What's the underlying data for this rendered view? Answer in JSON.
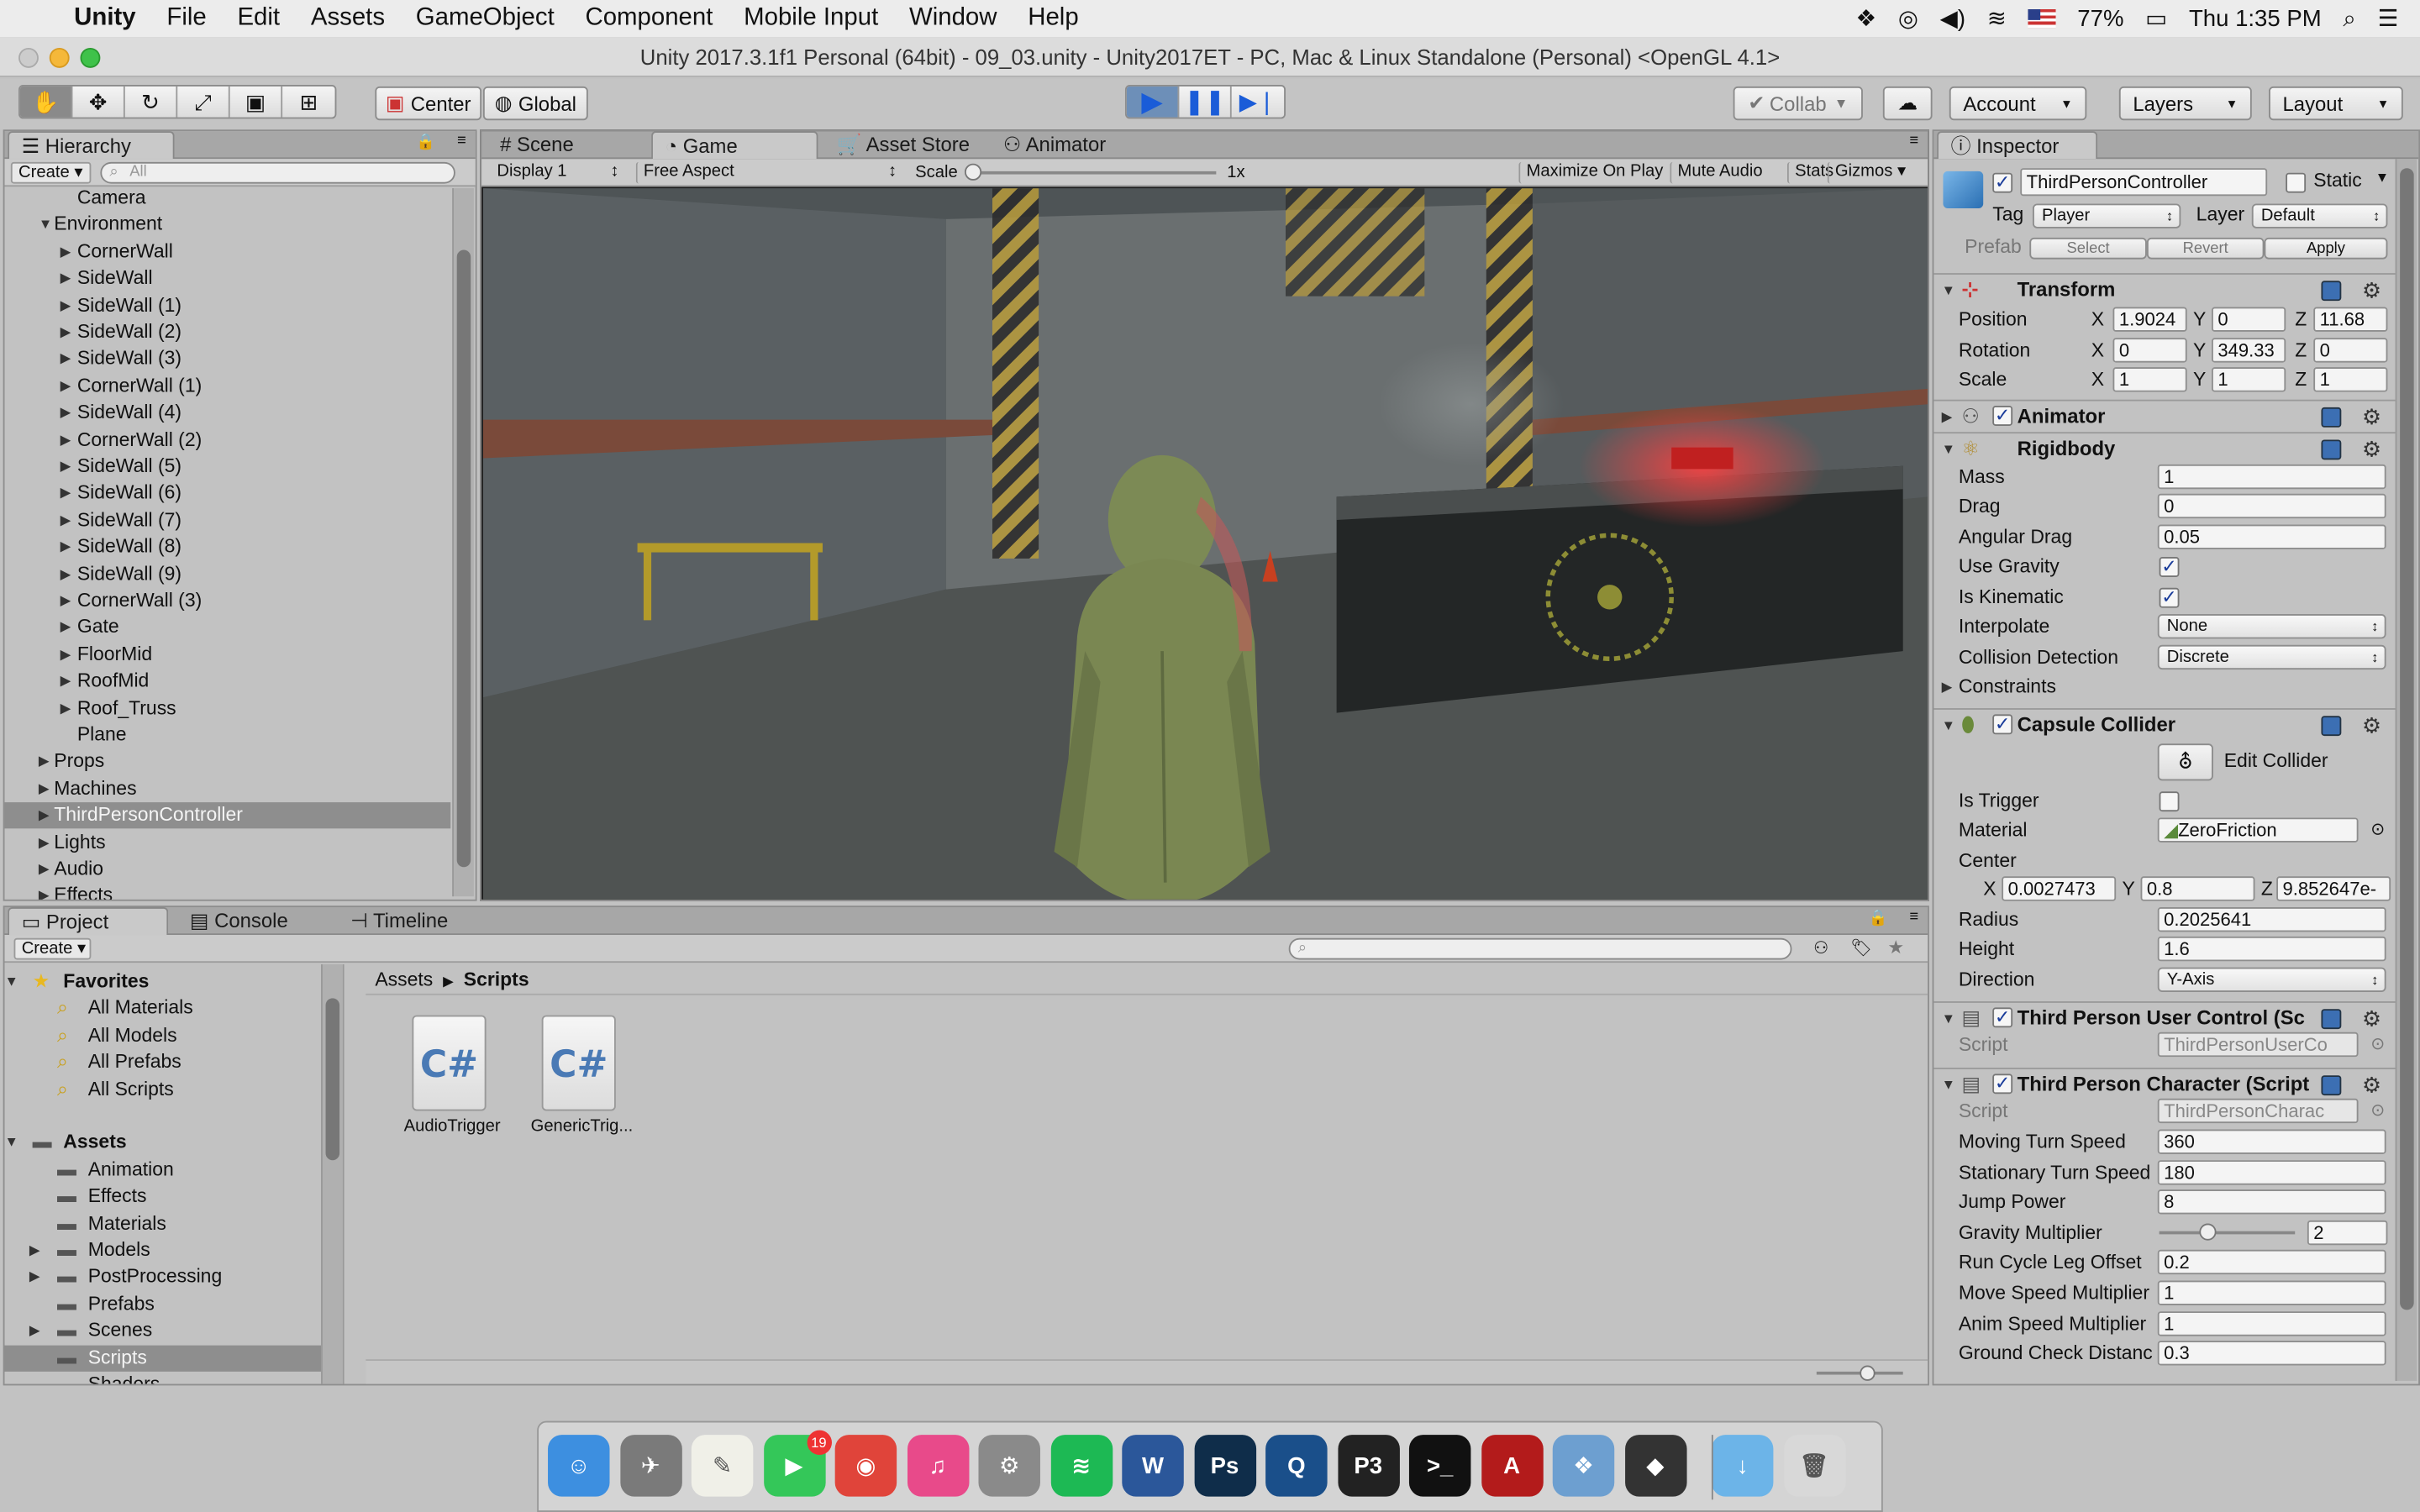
{
  "menubar": {
    "app": "Unity",
    "items": [
      "File",
      "Edit",
      "Assets",
      "GameObject",
      "Component",
      "Mobile Input",
      "Window",
      "Help"
    ],
    "battery": "77%",
    "clock": "Thu 1:35 PM"
  },
  "window": {
    "title": "Unity 2017.3.1f1 Personal (64bit) - 09_03.unity - Unity2017ET - PC, Mac & Linux Standalone (Personal) <OpenGL 4.1>"
  },
  "toolbar": {
    "pivot": "Center",
    "space": "Global",
    "collab": "Collab",
    "account": "Account",
    "layers": "Layers",
    "layout": "Layout"
  },
  "hierarchy": {
    "tab": "Hierarchy",
    "create": "Create",
    "search_placeholder": "All",
    "items": [
      {
        "label": "Camera",
        "indent": 2,
        "arrow": ""
      },
      {
        "label": "Environment",
        "indent": 1,
        "arrow": "down"
      },
      {
        "label": "CornerWall",
        "indent": 2,
        "arrow": "right"
      },
      {
        "label": "SideWall",
        "indent": 2,
        "arrow": "right"
      },
      {
        "label": "SideWall (1)",
        "indent": 2,
        "arrow": "right"
      },
      {
        "label": "SideWall (2)",
        "indent": 2,
        "arrow": "right"
      },
      {
        "label": "SideWall (3)",
        "indent": 2,
        "arrow": "right"
      },
      {
        "label": "CornerWall (1)",
        "indent": 2,
        "arrow": "right"
      },
      {
        "label": "SideWall (4)",
        "indent": 2,
        "arrow": "right"
      },
      {
        "label": "CornerWall (2)",
        "indent": 2,
        "arrow": "right"
      },
      {
        "label": "SideWall (5)",
        "indent": 2,
        "arrow": "right"
      },
      {
        "label": "SideWall (6)",
        "indent": 2,
        "arrow": "right"
      },
      {
        "label": "SideWall (7)",
        "indent": 2,
        "arrow": "right"
      },
      {
        "label": "SideWall (8)",
        "indent": 2,
        "arrow": "right"
      },
      {
        "label": "SideWall (9)",
        "indent": 2,
        "arrow": "right"
      },
      {
        "label": "CornerWall (3)",
        "indent": 2,
        "arrow": "right"
      },
      {
        "label": "Gate",
        "indent": 2,
        "arrow": "right"
      },
      {
        "label": "FloorMid",
        "indent": 2,
        "arrow": "right"
      },
      {
        "label": "RoofMid",
        "indent": 2,
        "arrow": "right"
      },
      {
        "label": "Roof_Truss",
        "indent": 2,
        "arrow": "right"
      },
      {
        "label": "Plane",
        "indent": 2,
        "arrow": ""
      },
      {
        "label": "Props",
        "indent": 1,
        "arrow": "right"
      },
      {
        "label": "Machines",
        "indent": 1,
        "arrow": "right"
      },
      {
        "label": "ThirdPersonController",
        "indent": 1,
        "arrow": "right",
        "selected": true
      },
      {
        "label": "Lights",
        "indent": 1,
        "arrow": "right"
      },
      {
        "label": "Audio",
        "indent": 1,
        "arrow": "right"
      },
      {
        "label": "Effects",
        "indent": 1,
        "arrow": "right"
      }
    ]
  },
  "game": {
    "tabs": [
      "Scene",
      "Game",
      "Asset Store",
      "Animator"
    ],
    "display": "Display 1",
    "aspect": "Free Aspect",
    "scale_label": "Scale",
    "scale_value": "1x",
    "buttons": [
      "Maximize On Play",
      "Mute Audio",
      "Stats",
      "Gizmos"
    ]
  },
  "project": {
    "tabs": [
      "Project",
      "Console",
      "Timeline"
    ],
    "create": "Create",
    "favorites": {
      "label": "Favorites",
      "items": [
        "All Materials",
        "All Models",
        "All Prefabs",
        "All Scripts"
      ]
    },
    "assets": {
      "label": "Assets",
      "items": [
        {
          "label": "Animation",
          "arrow": ""
        },
        {
          "label": "Effects",
          "arrow": ""
        },
        {
          "label": "Materials",
          "arrow": ""
        },
        {
          "label": "Models",
          "arrow": "right"
        },
        {
          "label": "PostProcessing",
          "arrow": "right"
        },
        {
          "label": "Prefabs",
          "arrow": ""
        },
        {
          "label": "Scenes",
          "arrow": "right"
        },
        {
          "label": "Scripts",
          "arrow": "",
          "selected": true
        },
        {
          "label": "Shaders",
          "arrow": ""
        }
      ]
    },
    "breadcrumb": [
      "Assets",
      "Scripts"
    ],
    "files": [
      {
        "label": "AudioTrigger",
        "glyph": "C#"
      },
      {
        "label": "GenericTrig...",
        "glyph": "C#"
      }
    ]
  },
  "inspector": {
    "tab": "Inspector",
    "object_name": "ThirdPersonController",
    "static_label": "Static",
    "tag_label": "Tag",
    "tag": "Player",
    "layer_label": "Layer",
    "layer": "Default",
    "prefab_label": "Prefab",
    "prefab_buttons": [
      "Select",
      "Revert",
      "Apply"
    ],
    "transform": {
      "title": "Transform",
      "rows": [
        {
          "label": "Position",
          "x": "1.9024",
          "y": "0",
          "z": "11.68"
        },
        {
          "label": "Rotation",
          "x": "0",
          "y": "349.33",
          "z": "0"
        },
        {
          "label": "Scale",
          "x": "1",
          "y": "1",
          "z": "1"
        }
      ]
    },
    "animator": {
      "title": "Animator"
    },
    "rigidbody": {
      "title": "Rigidbody",
      "mass_label": "Mass",
      "mass": "1",
      "drag_label": "Drag",
      "drag": "0",
      "angular_label": "Angular Drag",
      "angular": "0.05",
      "gravity_label": "Use Gravity",
      "kinematic_label": "Is Kinematic",
      "interpolate_label": "Interpolate",
      "interpolate": "None",
      "collision_label": "Collision Detection",
      "collision": "Discrete",
      "constraints_label": "Constraints"
    },
    "capsule": {
      "title": "Capsule Collider",
      "edit": "Edit Collider",
      "trigger_label": "Is Trigger",
      "material_label": "Material",
      "material": "ZeroFriction",
      "center_label": "Center",
      "cx": "0.0027473",
      "cy": "0.8",
      "cz": "9.852647e-",
      "radius_label": "Radius",
      "radius": "0.2025641",
      "height_label": "Height",
      "height": "1.6",
      "direction_label": "Direction",
      "direction": "Y-Axis"
    },
    "user_control": {
      "title": "Third Person User Control (Sc",
      "script_label": "Script",
      "script": "ThirdPersonUserCo"
    },
    "character": {
      "title": "Third Person Character (Script",
      "script_label": "Script",
      "script": "ThirdPersonCharac",
      "rows": [
        {
          "label": "Moving Turn Speed",
          "value": "360"
        },
        {
          "label": "Stationary Turn Speed",
          "value": "180"
        },
        {
          "label": "Jump Power",
          "value": "8"
        },
        {
          "label": "Gravity Multiplier",
          "value": "2",
          "slider": true
        },
        {
          "label": "Run Cycle Leg Offset",
          "value": "0.2"
        },
        {
          "label": "Move Speed Multiplier",
          "value": "1"
        },
        {
          "label": "Anim Speed Multiplier",
          "value": "1"
        },
        {
          "label": "Ground Check Distanc",
          "value": "0.3"
        }
      ]
    }
  },
  "dock": {
    "facetime_badge": "19",
    "apps": [
      {
        "name": "finder-icon",
        "color": "#3d8fe0",
        "glyph": "☺"
      },
      {
        "name": "rocket-icon",
        "color": "#7a7a7a",
        "glyph": "✈"
      },
      {
        "name": "notes-icon",
        "color": "#f0f0e8",
        "glyph": "✎"
      },
      {
        "name": "facetime-icon",
        "color": "#34c759",
        "glyph": "▶"
      },
      {
        "name": "chrome-icon",
        "color": "#e0443a",
        "glyph": "◉"
      },
      {
        "name": "itunes-icon",
        "color": "#e84a8a",
        "glyph": "♫"
      },
      {
        "name": "system-preferences-icon",
        "color": "#8a8a8a",
        "glyph": "⚙"
      },
      {
        "name": "spotify-icon",
        "color": "#1db954",
        "glyph": "≋"
      },
      {
        "name": "word-icon",
        "color": "#2b579a",
        "glyph": "W"
      },
      {
        "name": "photoshop-icon",
        "color": "#0f2d4a",
        "glyph": "Ps"
      },
      {
        "name": "quicktime-icon",
        "color": "#1a4f8a",
        "glyph": "Q"
      },
      {
        "name": "p3-icon",
        "color": "#222",
        "glyph": "P3"
      },
      {
        "name": "terminal-icon",
        "color": "#111",
        "glyph": ">_"
      },
      {
        "name": "acrobat-icon",
        "color": "#b31b1b",
        "glyph": "A"
      },
      {
        "name": "preview-icon",
        "color": "#6d9fd0",
        "glyph": "❖"
      },
      {
        "name": "unity-icon",
        "color": "#333",
        "glyph": "◆"
      },
      {
        "name": "downloads-folder-icon",
        "color": "#6cb4e8",
        "glyph": "↓"
      },
      {
        "name": "trash-icon",
        "color": "#d8d8d8",
        "glyph": "🗑"
      }
    ]
  }
}
